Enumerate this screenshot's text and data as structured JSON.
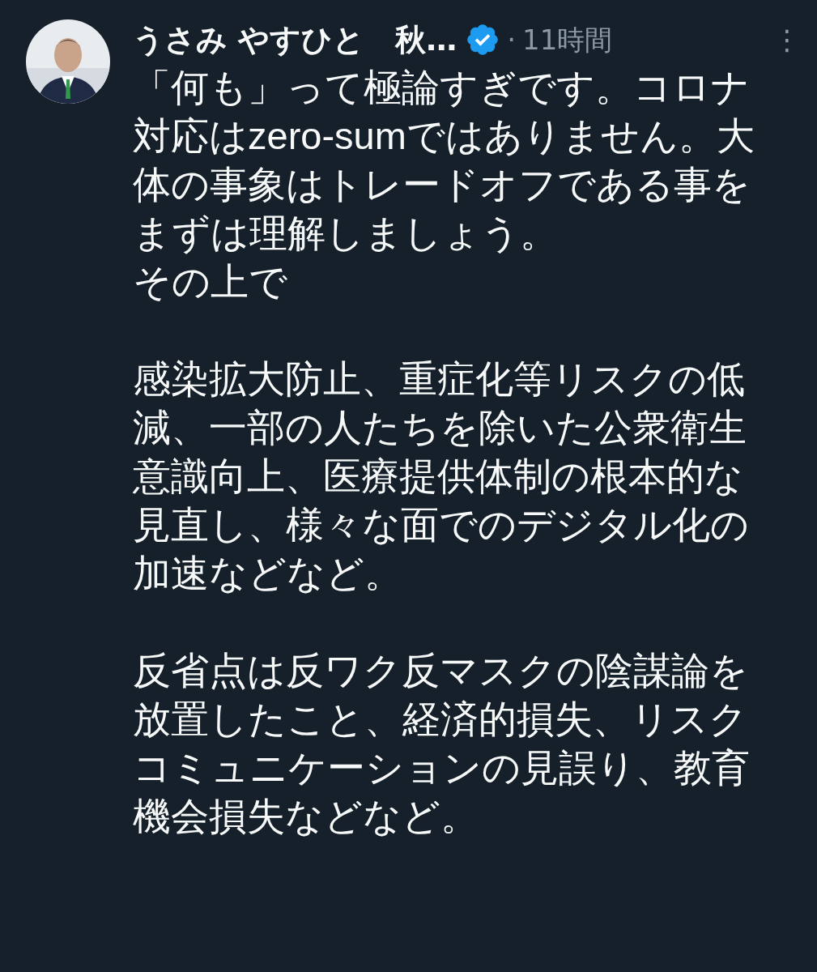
{
  "tweet": {
    "author_name": "うさみ やすひと　秋…",
    "verified": true,
    "separator": "·",
    "time": "11時間",
    "more": "⋮",
    "paragraphs": [
      [
        "「何も」って極論すぎです。コロナ対応はzero-sumではありません。大体の事象はトレードオフである事をまずは理解しましょう。",
        "その上で"
      ],
      [
        "感染拡大防止、重症化等リスクの低減、一部の人たちを除いた公衆衛生意識向上、医療提供体制の根本的な見直し、様々な面でのデジタル化の加速などなど。"
      ],
      [
        "反省点は反ワク反マスクの陰謀論を放置したこと、経済的損失、リスクコミュニケーションの見誤り、教育機会損失などなど。"
      ]
    ]
  }
}
